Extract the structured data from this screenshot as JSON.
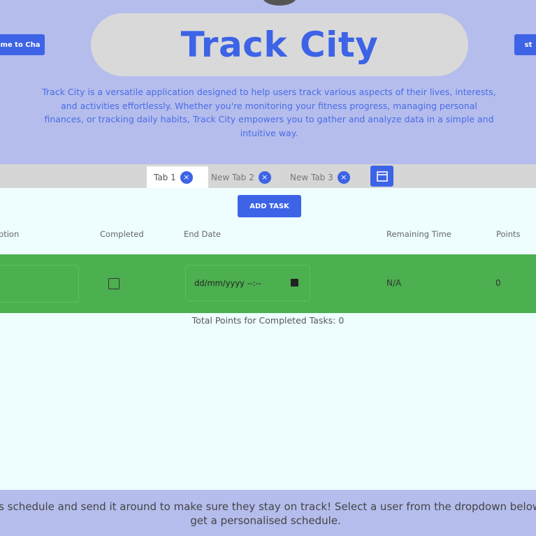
{
  "header": {
    "title": "Track City",
    "left_button": "me to Cha",
    "right_button": "st",
    "description": "Track City is a versatile application designed to help users track various aspects of their lives, interests, and activities effortlessly. Whether you're monitoring your fitness progress, managing personal finances, or tracking daily habits, Track City empowers you to gather and analyze data in a simple and intuitive way."
  },
  "tabs": [
    {
      "label": "Tab 1",
      "active": true
    },
    {
      "label": "New Tab 2",
      "active": false
    },
    {
      "label": "New Tab 3",
      "active": false
    }
  ],
  "toolbar": {
    "add_task": "ADD TASK"
  },
  "table": {
    "headers": [
      "ription",
      "Completed",
      "End Date",
      "Remaining Time",
      "Points"
    ],
    "row": {
      "description": "",
      "completed": false,
      "end_date_placeholder": "dd/mm/yyyy --:--",
      "remaining_time": "N/A",
      "points": "0"
    }
  },
  "total": "Total Points for Completed Tasks: 0",
  "footer": {
    "text": "one's schedule and send it around to make sure they stay on track! Select a user from the dropdown below to get a personalised schedule."
  },
  "colors": {
    "accent": "#3d63e6",
    "row": "#4caf50",
    "background": "#b4bdec"
  }
}
